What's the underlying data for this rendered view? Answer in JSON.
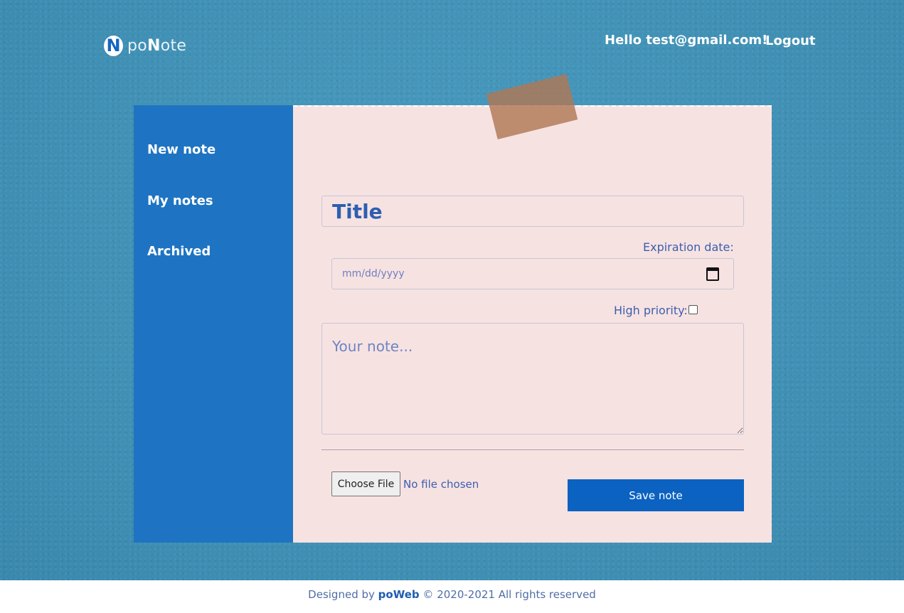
{
  "header": {
    "logo_letter": "N",
    "logo_prefix": "po",
    "logo_bold": "N",
    "logo_suffix": "ote",
    "greeting": "Hello test@gmail.com!",
    "logout_label": "Logout"
  },
  "sidebar": {
    "items": [
      {
        "label": "New note"
      },
      {
        "label": "My notes"
      },
      {
        "label": "Archived"
      }
    ]
  },
  "form": {
    "title_placeholder": "Title",
    "expiration_label": "Expiration date:",
    "date_placeholder": "mm/dd/yyyy",
    "priority_label": "High priority:",
    "note_placeholder": "Your note...",
    "file_button_label": "Choose File",
    "file_status": "No file chosen",
    "save_label": "Save note"
  },
  "footer": {
    "prefix": "Designed by",
    "brand": "poWeb",
    "suffix": "© 2020-2021 All rights reserved"
  },
  "colors": {
    "background": "#4595b9",
    "sidebar": "#1e74c2",
    "paper": "#f7e2e2",
    "accent": "#0b62c1",
    "text": "#3b5fae"
  },
  "icons": [
    "logo-mark-icon",
    "calendar-icon"
  ]
}
